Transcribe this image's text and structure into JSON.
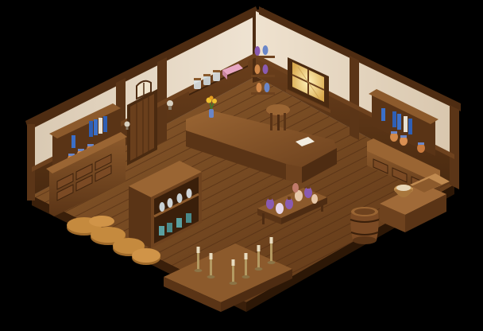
{
  "scene": {
    "background": "#000000",
    "palette": {
      "floor": "#7a4a24",
      "floor_dark": "#4e2c12",
      "plaster": "#e9dccb",
      "plaster_shade": "#cdbba5",
      "beam": "#5b3517",
      "beam_light": "#7b4a24",
      "wood": "#6a3f1c",
      "wood_light": "#8c5a2c",
      "sack": "#c58a3e",
      "glass_blue": "#6a86c8",
      "glass_purple": "#8a5bb0",
      "glass_teal": "#5aa0a0",
      "jar_amber": "#d2894a",
      "book_blue": "#2f5fb4",
      "candle": "#e8dcc0",
      "window_light": "#f1d486",
      "flower_yellow": "#f0c030",
      "pink_box": "#e7a6c2"
    },
    "icons": {
      "left_dresser": "cabinet-icon",
      "door": "door-icon",
      "counter": "shop-counter-icon",
      "stool": "stool-icon",
      "potion_shelf": "potion-shelf-icon",
      "potion_table": "potion-table-icon",
      "barrel": "barrel-icon",
      "right_dresser": "cabinet-icon",
      "crate": "crate-icon",
      "sacks": "grain-sack-icon",
      "candle_table": "candlestick-icon",
      "window": "window-icon",
      "wall_shelf": "wall-shelf-icon",
      "flower_vase": "flower-vase-icon",
      "lamp": "wall-lamp-icon"
    }
  }
}
